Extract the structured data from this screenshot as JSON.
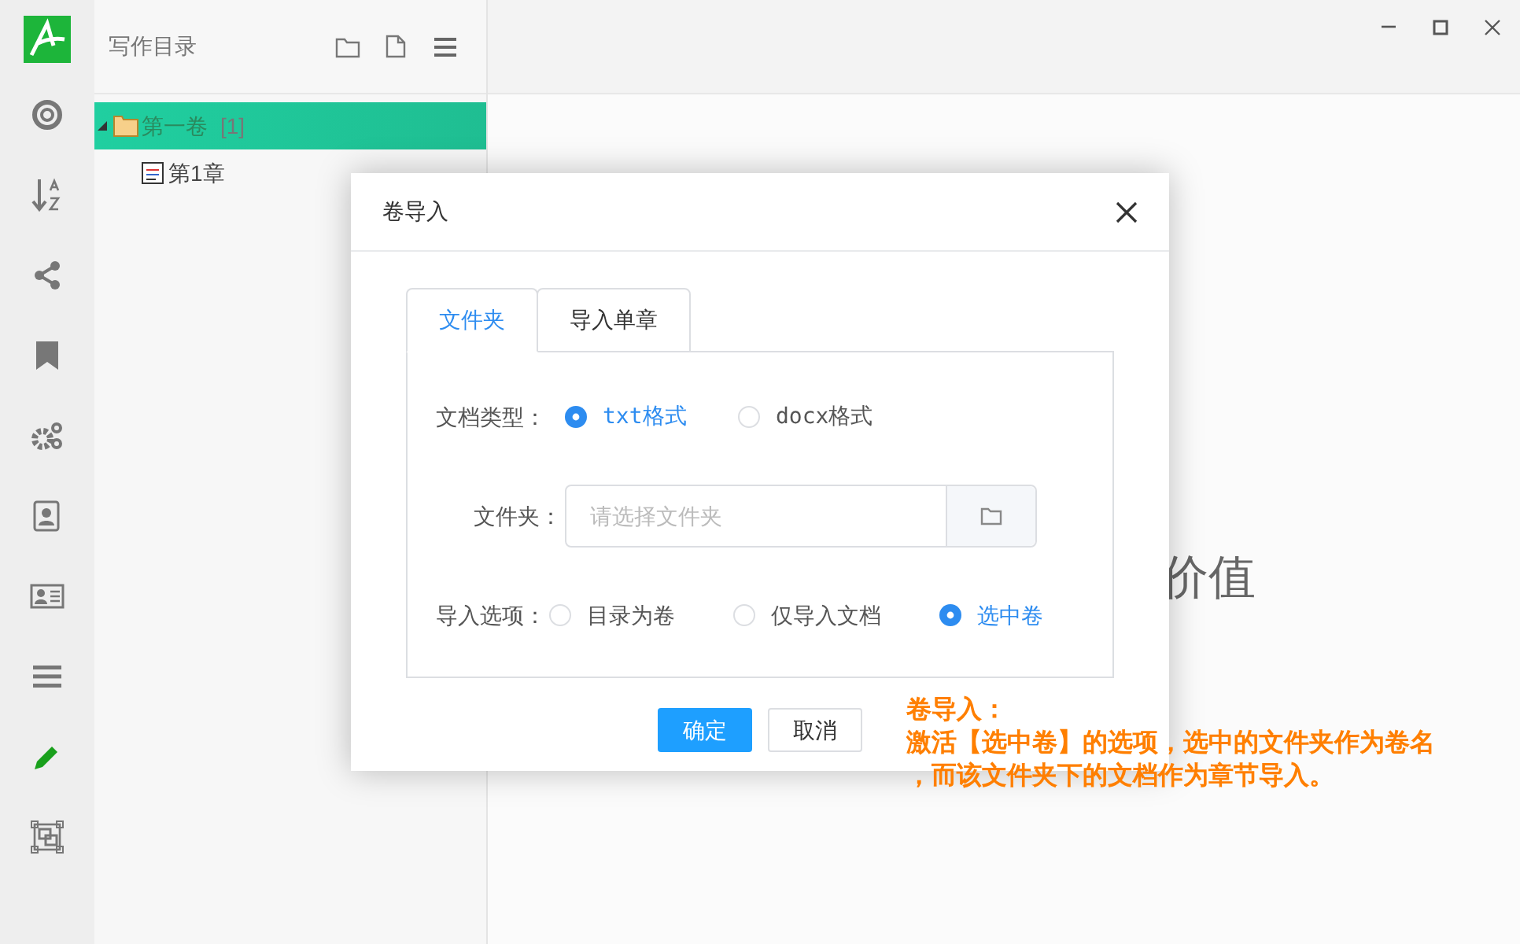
{
  "rail": {
    "items": [
      {
        "selected": false
      },
      {
        "selected": false
      },
      {
        "selected": false
      },
      {
        "selected": false
      },
      {
        "selected": false
      },
      {
        "selected": false
      },
      {
        "selected": false
      },
      {
        "selected": false
      },
      {
        "selected": true
      },
      {
        "selected": false
      }
    ]
  },
  "sidebar": {
    "title": "写作目录",
    "tree": [
      {
        "label": "第一卷",
        "count": "[1]",
        "selected": true,
        "expanded": true,
        "children": [
          {
            "label": "第1章",
            "selected": false
          }
        ]
      }
    ]
  },
  "main": {
    "background_text": "价值"
  },
  "dialog": {
    "title": "卷导入",
    "tabs": [
      {
        "label": "文件夹",
        "selected": true
      },
      {
        "label": "导入单章",
        "selected": false
      }
    ],
    "doc_type": {
      "label": "文档类型：",
      "options": [
        {
          "label": "txt格式",
          "selected": true
        },
        {
          "label": "docx格式",
          "selected": false
        }
      ]
    },
    "folder": {
      "label": "文件夹：",
      "placeholder": "请选择文件夹"
    },
    "import_options": {
      "label": "导入选项：",
      "options": [
        {
          "label": "目录为卷",
          "selected": false
        },
        {
          "label": "仅导入文档",
          "selected": false
        },
        {
          "label": "选中卷",
          "selected": true
        }
      ]
    },
    "buttons": [
      {
        "label": "确定",
        "kind": "primary"
      },
      {
        "label": "取消",
        "kind": "default"
      }
    ]
  },
  "annotation": {
    "title": "卷导入：",
    "lines": [
      "激活【选中卷】的选项，选中的文件夹作为卷名",
      "，而该文件夹下的文档作为章节导入。"
    ]
  }
}
